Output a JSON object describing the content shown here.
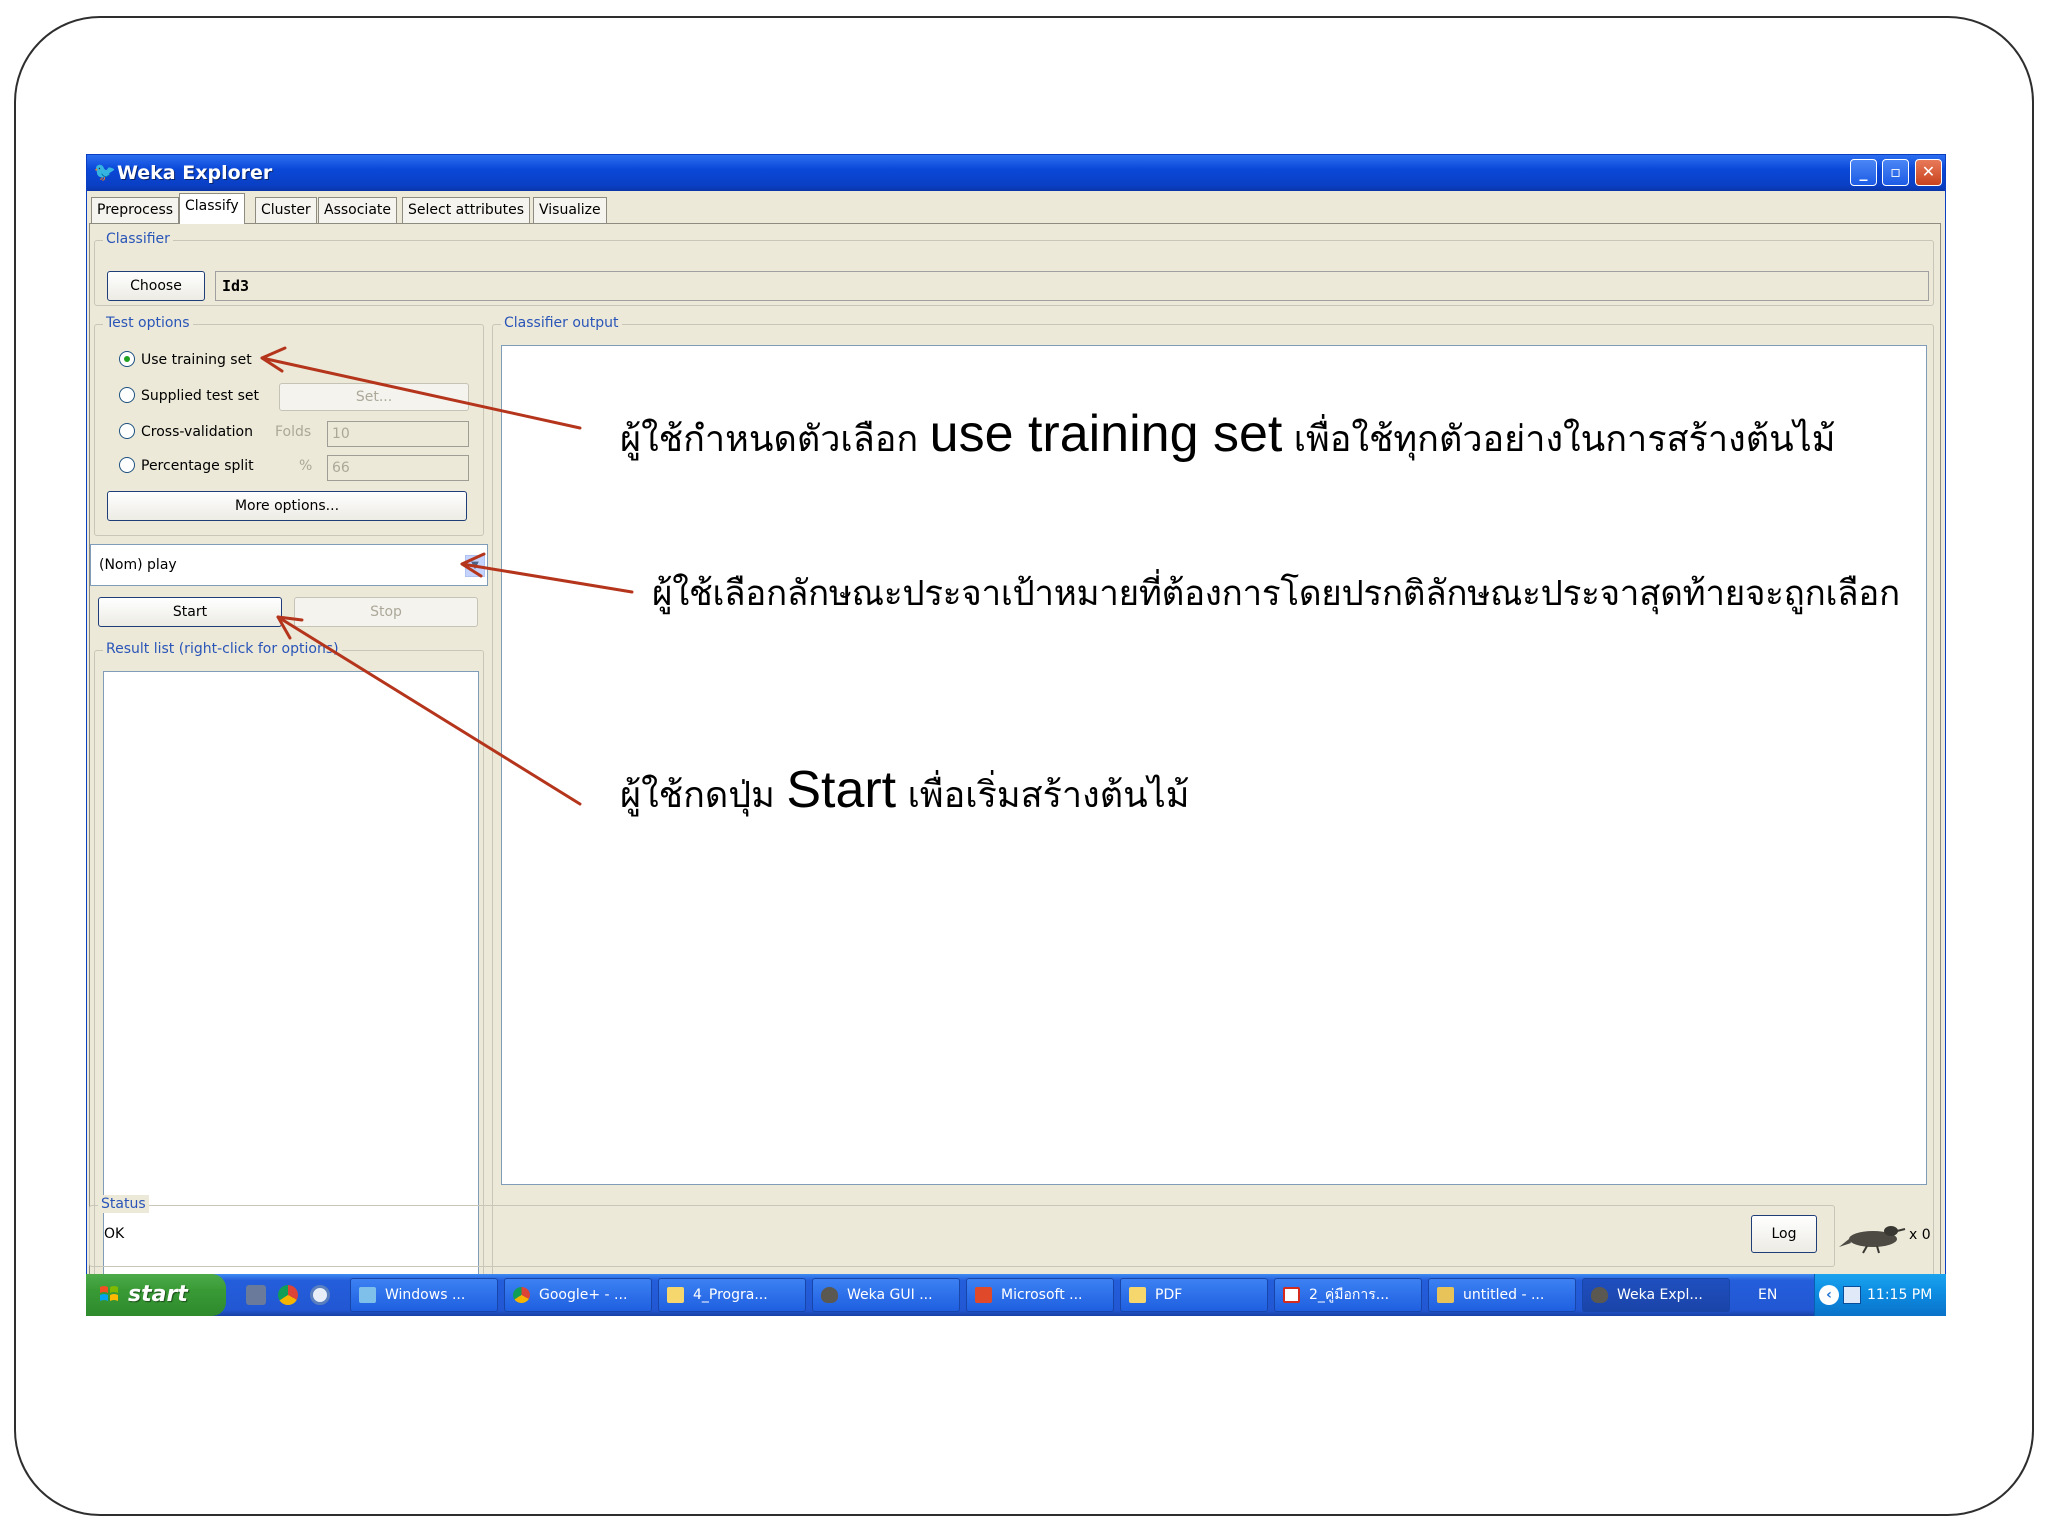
{
  "window": {
    "title": "Weka Explorer",
    "controls": {
      "minimize": "_",
      "maximize": "▫",
      "close": "✕"
    }
  },
  "tabs": [
    {
      "label": "Preprocess",
      "active": false
    },
    {
      "label": "Classify",
      "active": true
    },
    {
      "label": "Cluster",
      "active": false
    },
    {
      "label": "Associate",
      "active": false
    },
    {
      "label": "Select attributes",
      "active": false
    },
    {
      "label": "Visualize",
      "active": false
    }
  ],
  "classifier": {
    "group_title": "Classifier",
    "choose_label": "Choose",
    "value": "Id3"
  },
  "test_options": {
    "group_title": "Test options",
    "use_training_set": "Use training set",
    "supplied_test_set": "Supplied test set",
    "set_button": "Set...",
    "cross_validation": "Cross-validation",
    "folds_label": "Folds",
    "folds_value": "10",
    "percentage_split": "Percentage split",
    "percent_label": "%",
    "percent_value": "66",
    "more_options": "More options..."
  },
  "class_attribute": {
    "value": "(Nom) play"
  },
  "run": {
    "start_label": "Start",
    "stop_label": "Stop"
  },
  "result_list": {
    "group_title": "Result list (right-click for options)"
  },
  "output": {
    "group_title": "Classifier output"
  },
  "status": {
    "group_title": "Status",
    "text": "OK",
    "log_label": "Log",
    "x_label": "x 0"
  },
  "taskbar": {
    "start_label": "start",
    "tasks": [
      {
        "label": "Windows ...",
        "icon": "windows-live-icon",
        "active": false
      },
      {
        "label": "Google+ - ...",
        "icon": "chrome-icon",
        "active": false
      },
      {
        "label": "4_Progra...",
        "icon": "folder-icon",
        "active": false
      },
      {
        "label": "Weka GUI ...",
        "icon": "weka-bird-icon",
        "active": false
      },
      {
        "label": "Microsoft ...",
        "icon": "office-icon",
        "active": false
      },
      {
        "label": "PDF",
        "icon": "folder-icon",
        "active": false
      },
      {
        "label": "2_คู่มือการ...",
        "icon": "pdf-icon",
        "active": false
      },
      {
        "label": "untitled - ...",
        "icon": "paint-icon",
        "active": false
      },
      {
        "label": "Weka Expl...",
        "icon": "weka-bird-icon",
        "active": true
      }
    ],
    "language": "EN",
    "time": "11:15 PM"
  },
  "annotations": {
    "training_prefix": "ผู้ใช้กำหนดตัวเลือก ",
    "training_en": "use training set",
    "training_suffix": " เพื่อใช้ทุกตัวอย่างในการสร้างต้นไม้",
    "target_text": "ผู้ใช้เลือกลักษณะประจาเป้าหมายที่ต้องการโดยปรกติลักษณะประจาสุดท้ายจะถูกเลือก",
    "start_prefix": "ผู้ใช้กดปุ่ม ",
    "start_en": "Start",
    "start_suffix": " เพื่อเริ่มสร้างต้นไม้"
  },
  "colors": {
    "titlebar": "#0a48d8",
    "group_title": "#2a55b8",
    "arrow": "#b5351c",
    "taskbar": "#245edb",
    "start": "#389a35"
  }
}
